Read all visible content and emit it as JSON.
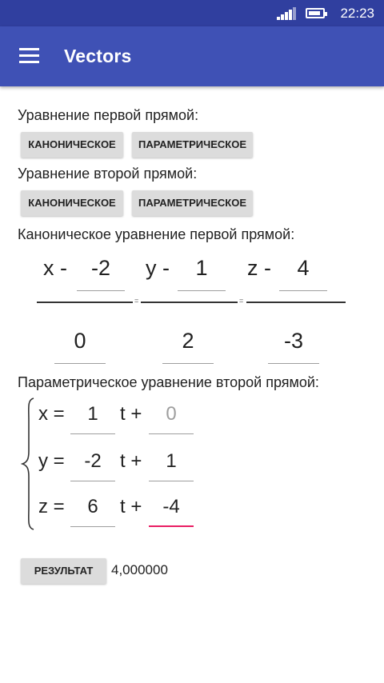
{
  "status_bar": {
    "time": "22:23",
    "signal_icon": "signal-icon",
    "battery_icon": "battery-icon"
  },
  "app_bar": {
    "title": "Vectors",
    "menu_icon": "menu-icon"
  },
  "line1": {
    "label": "Уравнение первой прямой:",
    "canonical_button": "КАНОНИЧЕСКОЕ",
    "parametric_button": "ПАРАМЕТРИЧЕСКОЕ"
  },
  "line2": {
    "label": "Уравнение второй прямой:",
    "canonical_button": "КАНОНИЧЕСКОЕ",
    "parametric_button": "ПАРАМЕТРИЧЕСКОЕ"
  },
  "canonical": {
    "label": "Каноническое уравнение первой прямой:",
    "x_prefix": "x -",
    "y_prefix": "y -",
    "z_prefix": "z -",
    "x0": "-2",
    "y0": "1",
    "z0": "4",
    "a": "0",
    "b": "2",
    "c": "-3",
    "eq1": "=",
    "eq2": "="
  },
  "parametric": {
    "label": "Параметрическое уравнение второй прямой:",
    "x_label": "x =",
    "y_label": "y =",
    "z_label": "z =",
    "t_plus": "t +",
    "x_coef": "1",
    "x_const": "0",
    "y_coef": "-2",
    "y_const": "1",
    "z_coef": "6",
    "z_const": "-4"
  },
  "result": {
    "button": "РЕЗУЛЬТАТ",
    "value": "4,000000"
  },
  "colors": {
    "status_bar": "#303f9f",
    "app_bar": "#3f51b5",
    "focus_underline": "#e91e63",
    "hint_text": "#9e9e9e"
  }
}
